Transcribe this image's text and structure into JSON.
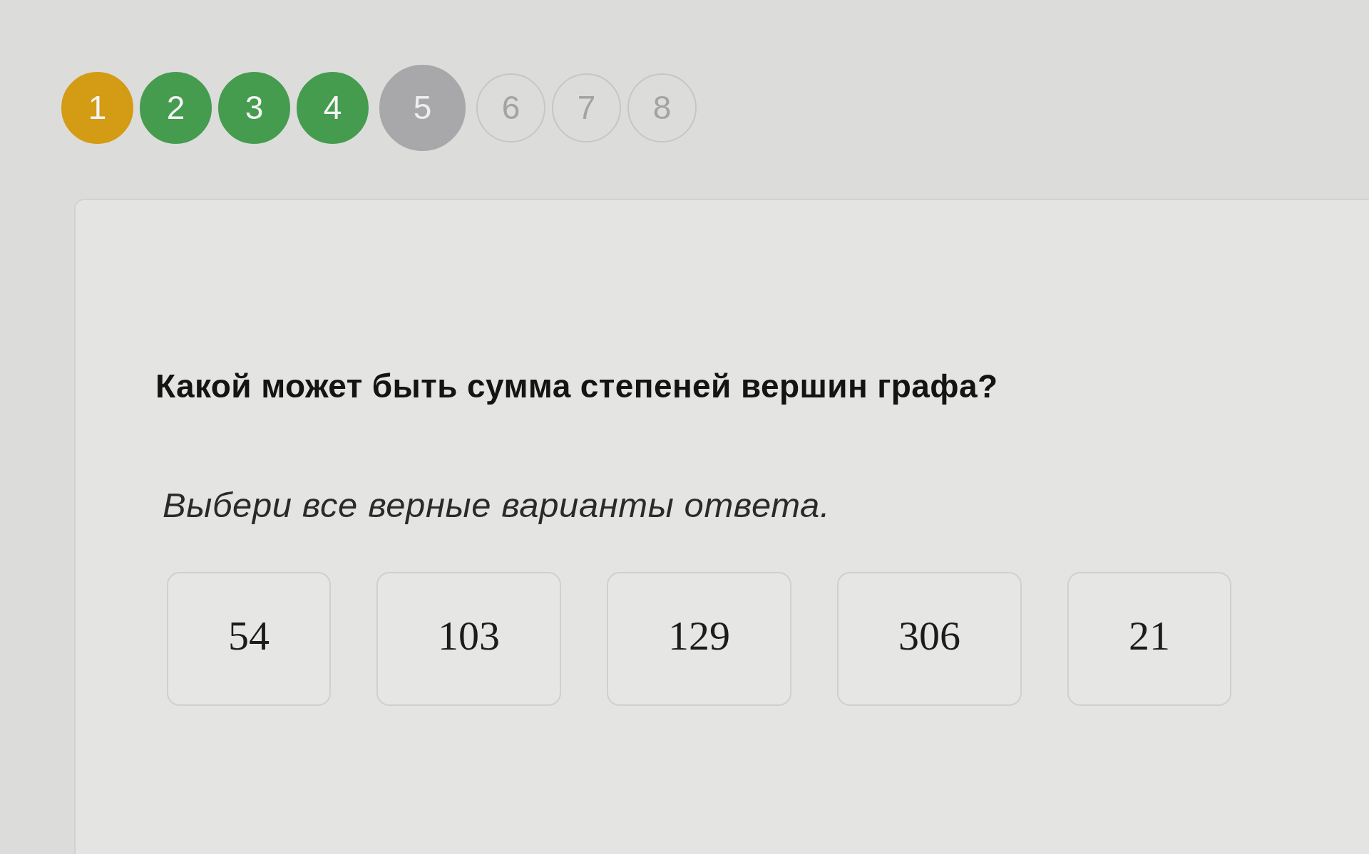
{
  "steps": [
    {
      "label": "1",
      "kind": "answered",
      "color": "#d49b14",
      "selected": false
    },
    {
      "label": "2",
      "kind": "answered",
      "color": "#459c4f",
      "selected": false
    },
    {
      "label": "3",
      "kind": "answered",
      "color": "#459c4f",
      "selected": false
    },
    {
      "label": "4",
      "kind": "answered",
      "color": "#459c4f",
      "selected": false
    },
    {
      "label": "5",
      "kind": "open",
      "selected": true
    },
    {
      "label": "6",
      "kind": "open",
      "selected": false
    },
    {
      "label": "7",
      "kind": "open",
      "selected": false
    },
    {
      "label": "8",
      "kind": "open",
      "selected": false
    }
  ],
  "question": {
    "text": "Какой может быть сумма степеней вершин графа?",
    "instruction": "Выбери все верные варианты ответа.",
    "options": [
      {
        "label": "54",
        "selected": false
      },
      {
        "label": "103",
        "selected": false
      },
      {
        "label": "129",
        "selected": false
      },
      {
        "label": "306",
        "selected": false
      },
      {
        "label": "21",
        "selected": false
      }
    ]
  }
}
